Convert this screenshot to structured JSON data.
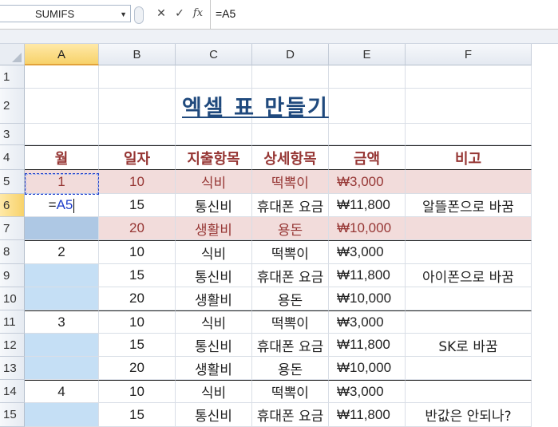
{
  "formula_bar": {
    "name_box": "SUMIFS",
    "cancel_icon": "✕",
    "enter_icon": "✓",
    "fx_label": "fx",
    "formula": "=A5"
  },
  "columns": [
    "A",
    "B",
    "C",
    "D",
    "E",
    "F"
  ],
  "rows": [
    "1",
    "2",
    "3",
    "4",
    "5",
    "6",
    "7",
    "8",
    "9",
    "10",
    "11",
    "12",
    "13",
    "14",
    "15"
  ],
  "title": "엑셀 표 만들기",
  "headers": [
    "월",
    "일자",
    "지출항목",
    "상세항목",
    "금액",
    "비고"
  ],
  "editing": {
    "prefix": "=",
    "ref": "A5"
  },
  "table": [
    [
      "1",
      "10",
      "식비",
      "떡뽁이",
      "₩3,000",
      ""
    ],
    [
      "",
      "15",
      "통신비",
      "휴대폰 요금",
      "₩11,800",
      "알뜰폰으로 바꿈"
    ],
    [
      "",
      "20",
      "생활비",
      "용돈",
      "₩10,000",
      ""
    ],
    [
      "2",
      "10",
      "식비",
      "떡뽁이",
      "₩3,000",
      ""
    ],
    [
      "",
      "15",
      "통신비",
      "휴대폰 요금",
      "₩11,800",
      "아이폰으로 바꿈"
    ],
    [
      "",
      "20",
      "생활비",
      "용돈",
      "₩10,000",
      ""
    ],
    [
      "3",
      "10",
      "식비",
      "떡뽁이",
      "₩3,000",
      ""
    ],
    [
      "",
      "15",
      "통신비",
      "휴대폰 요금",
      "₩11,800",
      "SK로 바꿈"
    ],
    [
      "",
      "20",
      "생활비",
      "용돈",
      "₩10,000",
      ""
    ],
    [
      "4",
      "10",
      "식비",
      "떡뽁이",
      "₩3,000",
      ""
    ],
    [
      "",
      "15",
      "통신비",
      "휴대폰 요금",
      "₩11,800",
      "반값은 안되나?"
    ]
  ],
  "colors": {
    "header_text": "#963634",
    "title": "#1f497d",
    "pink_fill": "#f2dcdb",
    "blue_fill": "#c5dff5",
    "selection": "#1f3ec9"
  }
}
